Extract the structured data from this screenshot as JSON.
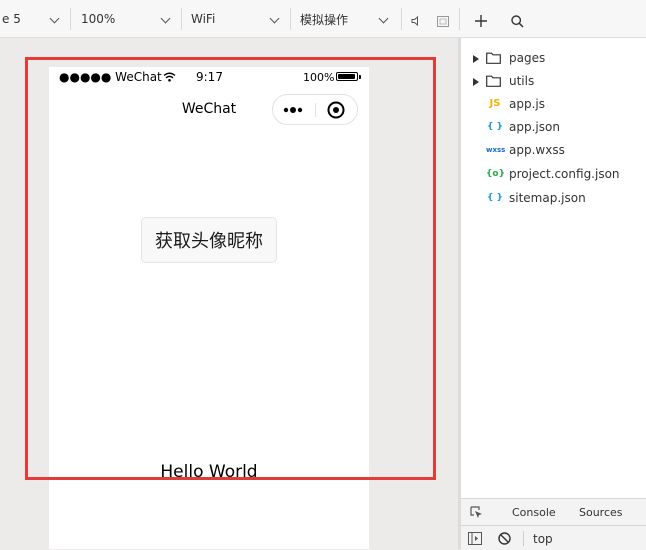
{
  "toolbar": {
    "device": "e 5",
    "zoom": "100%",
    "network": "WiFi",
    "operation": "模拟操作"
  },
  "phone": {
    "carrier": "●●●●● WeChat",
    "time": "9:17",
    "battery_pct": "100%",
    "battery_level": 1.0,
    "nav_title": "WeChat",
    "avatar_button": "获取头像昵称",
    "hello": "Hello World"
  },
  "explorer": {
    "folders": [
      "pages",
      "utils"
    ],
    "files": [
      {
        "icon": "JS",
        "name": "app.js",
        "color": "#f5b400"
      },
      {
        "icon": "{ }",
        "name": "app.json",
        "color": "#1a9ad6"
      },
      {
        "icon": "wxss",
        "name": "app.wxss",
        "color": "#1a6ad6"
      },
      {
        "icon": "{o}",
        "name": "project.config.json",
        "color": "#2aa84a"
      },
      {
        "icon": "{ }",
        "name": "sitemap.json",
        "color": "#1a9ad6"
      }
    ]
  },
  "devtools": {
    "tabs": [
      "Console",
      "Sources"
    ],
    "context": "top"
  },
  "colors": {
    "highlight_frame": "#e53a3a",
    "background": "#ecebe9"
  }
}
